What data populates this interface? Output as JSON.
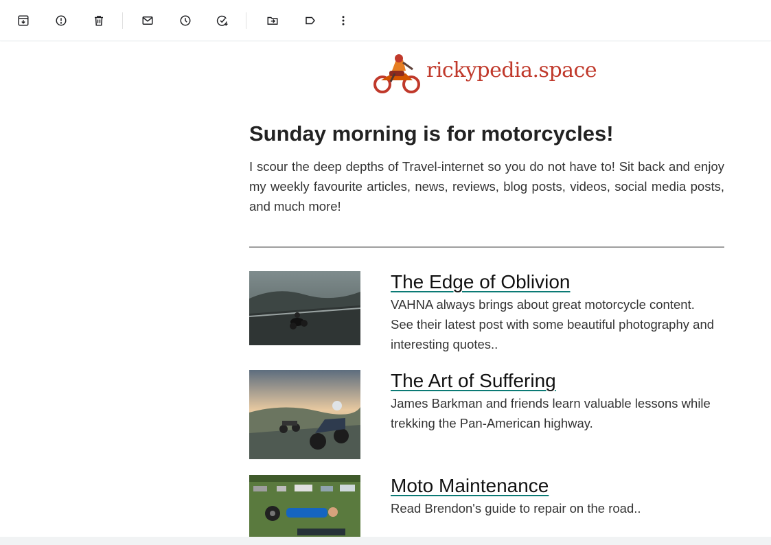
{
  "toolbar": {
    "buttons": [
      {
        "icon": "archive-icon",
        "label": "Archive"
      },
      {
        "icon": "report-spam-icon",
        "label": "Report spam"
      },
      {
        "icon": "delete-icon",
        "label": "Delete"
      },
      {
        "icon": "mark-unread-icon",
        "label": "Mark as unread"
      },
      {
        "icon": "snooze-icon",
        "label": "Snooze"
      },
      {
        "icon": "add-task-icon",
        "label": "Add to tasks"
      },
      {
        "icon": "move-to-icon",
        "label": "Move to"
      },
      {
        "icon": "label-icon",
        "label": "Labels"
      },
      {
        "icon": "more-icon",
        "label": "More"
      }
    ]
  },
  "email": {
    "brand": {
      "name": "rickypedia.space",
      "color": "#c0392b"
    },
    "headline": "Sunday morning is for motorcycles!",
    "intro": "I scour the deep depths of Travel-internet so you do not have to! Sit back and enjoy my weekly favourite articles, news, reviews, blog posts, videos, social media posts, and much more!",
    "articles": [
      {
        "title": "The Edge of Oblivion",
        "description": "VAHNA always brings about great motorcycle content. See their latest post with some beautiful photography and interesting quotes.."
      },
      {
        "title": "The Art of Suffering",
        "description": "James Barkman and friends learn valuable lessons while trekking the Pan-American highway."
      },
      {
        "title": "Moto Maintenance",
        "description": "Read Brendon's guide to repair on the road.."
      }
    ],
    "link_underline_color": "#0b7a75"
  }
}
